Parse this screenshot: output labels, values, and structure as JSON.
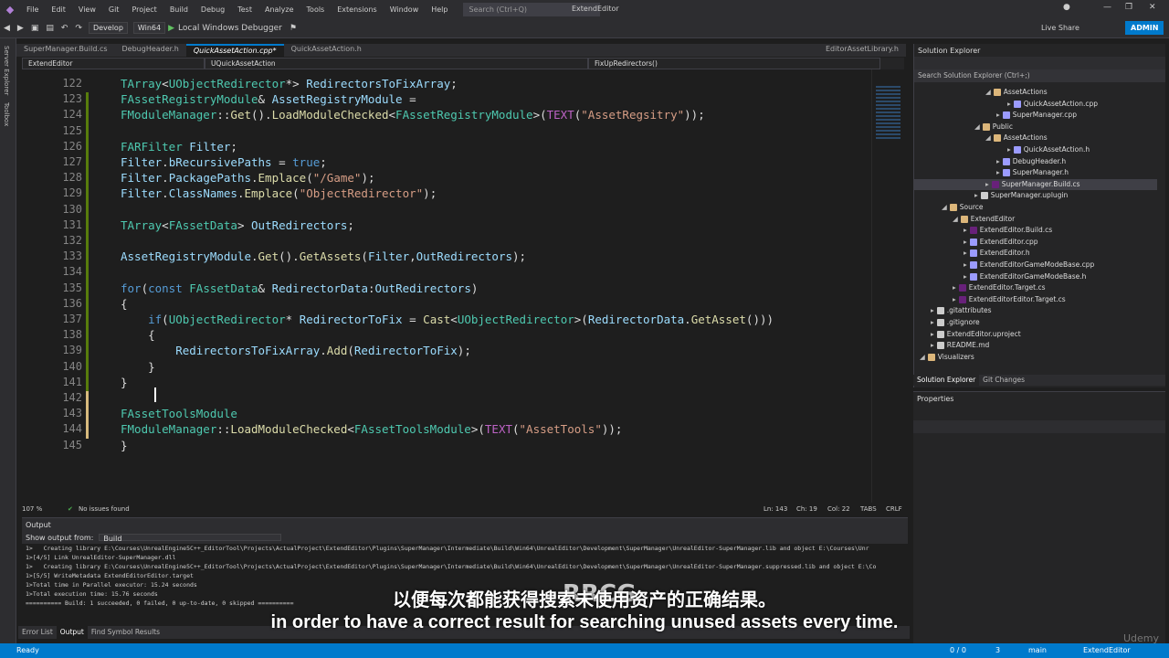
{
  "menubar": {
    "items": [
      "File",
      "Edit",
      "View",
      "Git",
      "Project",
      "Build",
      "Debug",
      "Test",
      "Analyze",
      "Tools",
      "Extensions",
      "Window",
      "Help"
    ],
    "search_placeholder": "Search (Ctrl+Q)",
    "window_title": "ExtendEditor"
  },
  "toolbar": {
    "config": "Develop",
    "platform": "Win64",
    "debugger": "Local Windows Debugger",
    "live_share": "Live Share",
    "user": "ADMIN"
  },
  "side_strip": {
    "items": [
      "Server Explorer",
      "Toolbox"
    ]
  },
  "tabs": [
    {
      "label": "SuperManager.Build.cs"
    },
    {
      "label": "DebugHeader.h"
    },
    {
      "label": "QuickAssetAction.cpp*"
    },
    {
      "label": "QuickAssetAction.h"
    },
    {
      "label": "EditorAssetLibrary.h"
    }
  ],
  "navbar": {
    "project": "ExtendEditor",
    "scope": "UQuickAssetAction",
    "member": "FixUpRedirectors()"
  },
  "editor": {
    "lines": [
      {
        "n": "122",
        "t": "TArray<UObjectRedirector*> RedirectorsToFixArray;"
      },
      {
        "n": "123",
        "t": "FAssetRegistryModule& AssetRegistryModule ="
      },
      {
        "n": "124",
        "t": "FModuleManager::Get().LoadModuleChecked<FAssetRegistryModule>(TEXT(\"AssetRegsitry\"));"
      },
      {
        "n": "125",
        "t": ""
      },
      {
        "n": "126",
        "t": "FARFilter Filter;"
      },
      {
        "n": "127",
        "t": "Filter.bRecursivePaths = true;"
      },
      {
        "n": "128",
        "t": "Filter.PackagePaths.Emplace(\"/Game\");"
      },
      {
        "n": "129",
        "t": "Filter.ClassNames.Emplace(\"ObjectRedirector\");"
      },
      {
        "n": "130",
        "t": ""
      },
      {
        "n": "131",
        "t": "TArray<FAssetData> OutRedirectors;"
      },
      {
        "n": "132",
        "t": ""
      },
      {
        "n": "133",
        "t": "AssetRegistryModule.Get().GetAssets(Filter,OutRedirectors);"
      },
      {
        "n": "134",
        "t": ""
      },
      {
        "n": "135",
        "t": "for(const FAssetData& RedirectorData:OutRedirectors)"
      },
      {
        "n": "136",
        "t": "{"
      },
      {
        "n": "137",
        "t": "    if(UObjectRedirector* RedirectorToFix = Cast<UObjectRedirector>(RedirectorData.GetAsset()))"
      },
      {
        "n": "138",
        "t": "    {"
      },
      {
        "n": "139",
        "t": "        RedirectorsToFixArray.Add(RedirectorToFix);"
      },
      {
        "n": "140",
        "t": "    }"
      },
      {
        "n": "141",
        "t": "}"
      },
      {
        "n": "142",
        "t": ""
      },
      {
        "n": "143",
        "t": "FAssetToolsModule"
      },
      {
        "n": "144",
        "t": "FModuleManager::LoadModuleChecked<FAssetToolsModule>(TEXT(\"AssetTools\"));"
      },
      {
        "n": "145",
        "t": "}"
      }
    ]
  },
  "status_line": {
    "zoom": "107 %",
    "issues": "No issues found",
    "ln": "Ln: 143",
    "ch": "Ch: 19",
    "col": "Col: 22",
    "tabs": "TABS",
    "eol": "CRLF"
  },
  "output": {
    "title": "Output",
    "show_from_label": "Show output from:",
    "show_from_value": "Build",
    "lines": [
      "1>   Creating library E:\\Courses\\UnrealEngine5C++_EditorTool\\Projects\\ActualProject\\ExtendEditor\\Plugins\\SuperManager\\Intermediate\\Build\\Win64\\UnrealEditor\\Development\\SuperManager\\UnrealEditor-SuperManager.lib and object E:\\Courses\\Unr",
      "1>[4/5] Link UnrealEditor-SuperManager.dll",
      "1>   Creating library E:\\Courses\\UnrealEngine5C++_EditorTool\\Projects\\ActualProject\\ExtendEditor\\Plugins\\SuperManager\\Intermediate\\Build\\Win64\\UnrealEditor\\Development\\SuperManager\\UnrealEditor-SuperManager.suppressed.lib and object E:\\Co",
      "1>[5/5] WriteMetadata ExtendEditorEditor.target",
      "1>Total time in Parallel executor: 15.24 seconds",
      "1>Total execution time: 15.76 seconds",
      "========== Build: 1 succeeded, 0 failed, 0 up-to-date, 0 skipped =========="
    ]
  },
  "bottom_tabs": [
    "Error List",
    "Output",
    "Find Symbol Results"
  ],
  "solution_explorer": {
    "title": "Solution Explorer",
    "search_placeholder": "Search Solution Explorer (Ctrl+;)",
    "nodes": [
      {
        "label": "AssetActions",
        "kind": "folder",
        "depth": 6
      },
      {
        "label": "QuickAssetAction.cpp",
        "kind": "cpp",
        "depth": 8
      },
      {
        "label": "SuperManager.cpp",
        "kind": "cpp",
        "depth": 7
      },
      {
        "label": "Public",
        "kind": "folder",
        "depth": 5
      },
      {
        "label": "AssetActions",
        "kind": "folder",
        "depth": 6
      },
      {
        "label": "QuickAssetAction.h",
        "kind": "h",
        "depth": 8
      },
      {
        "label": "DebugHeader.h",
        "kind": "h",
        "depth": 7
      },
      {
        "label": "SuperManager.h",
        "kind": "h",
        "depth": 7
      },
      {
        "label": "SuperManager.Build.cs",
        "kind": "cs",
        "depth": 6
      },
      {
        "label": "SuperManager.uplugin",
        "kind": "file",
        "depth": 5
      },
      {
        "label": "Source",
        "kind": "folder",
        "depth": 2
      },
      {
        "label": "ExtendEditor",
        "kind": "folder",
        "depth": 3
      },
      {
        "label": "ExtendEditor.Build.cs",
        "kind": "cs",
        "depth": 4
      },
      {
        "label": "ExtendEditor.cpp",
        "kind": "cpp",
        "depth": 4
      },
      {
        "label": "ExtendEditor.h",
        "kind": "h",
        "depth": 4
      },
      {
        "label": "ExtendEditorGameModeBase.cpp",
        "kind": "cpp",
        "depth": 4
      },
      {
        "label": "ExtendEditorGameModeBase.h",
        "kind": "h",
        "depth": 4
      },
      {
        "label": "ExtendEditor.Target.cs",
        "kind": "cs",
        "depth": 3
      },
      {
        "label": "ExtendEditorEditor.Target.cs",
        "kind": "cs",
        "depth": 3
      },
      {
        "label": ".gitattributes",
        "kind": "file",
        "depth": 1
      },
      {
        "label": ".gitignore",
        "kind": "file",
        "depth": 1
      },
      {
        "label": "ExtendEditor.uproject",
        "kind": "file",
        "depth": 1
      },
      {
        "label": "README.md",
        "kind": "file",
        "depth": 1
      },
      {
        "label": "Visualizers",
        "kind": "folder",
        "depth": 0
      }
    ]
  },
  "se_tabs": [
    "Solution Explorer",
    "Git Changes"
  ],
  "properties": {
    "title": "Properties"
  },
  "statusbar": {
    "ready": "Ready",
    "lines_info": "0 / 0",
    "errors": "3",
    "branch": "main",
    "project": "ExtendEditor"
  },
  "overlay": {
    "subtitle_cn": "以便每次都能获得搜索未使用资产的正确结果。",
    "subtitle_en": "in order to have a correct result for searching unused assets every time.",
    "watermark": "RRCG",
    "udemy": "Udemy"
  }
}
